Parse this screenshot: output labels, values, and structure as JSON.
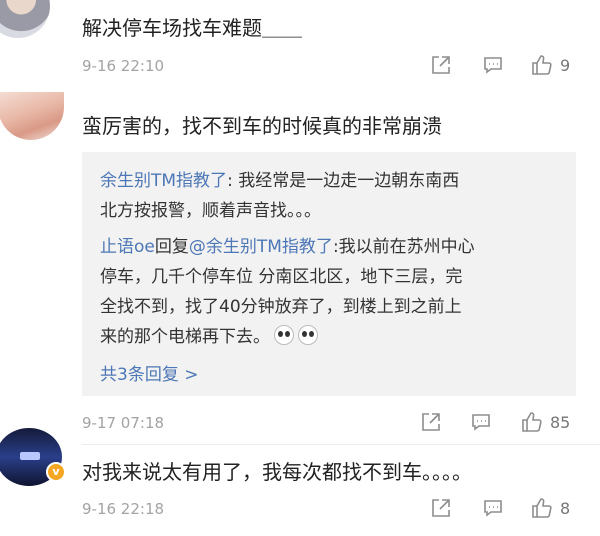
{
  "comments": [
    {
      "text": "解决停车场找车难题＿＿",
      "time": "9-16 22:10",
      "likes": "9"
    },
    {
      "text": "蛮厉害的，找不到车的时候真的非常崩溃",
      "time": "9-17 07:18",
      "likes": "85",
      "replies": {
        "r1_user": "余生别TM指教了",
        "r1_line1": ": 我经常是一边走一边朝东南西",
        "r1_line2": "北方按报警，顺着声音找。。。",
        "r2_user": "止语oe",
        "r2_mid": "回复",
        "r2_at": "@余生别TM指教了",
        "r2_line1": ":我以前在苏州中心",
        "r2_line2": "停车，几千个停车位 分南区北区，地下三层，完",
        "r2_line3": "全找不到，找了40分钟放弃了，到楼上到之前上",
        "r2_line4": "来的那个电梯再下去。",
        "more": "共3条回复 >"
      }
    },
    {
      "text": "对我来说太有用了，我每次都找不到车。。。。",
      "time": "9-16 22:18",
      "likes": "8"
    }
  ]
}
